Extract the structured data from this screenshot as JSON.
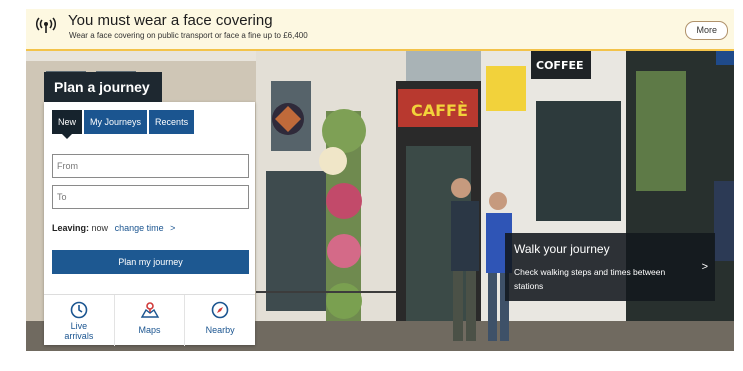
{
  "alert": {
    "icon": "signal-broadcast-icon",
    "title": "You must wear a face covering",
    "subtitle": "Wear a face covering on public transport or face a fine up to £6,400",
    "more_label": "More"
  },
  "scene": {
    "coffee_sign": "COFFEE"
  },
  "planner": {
    "title": "Plan a journey",
    "tabs": [
      {
        "label": "New"
      },
      {
        "label": "My Journeys"
      },
      {
        "label": "Recents"
      }
    ],
    "from_placeholder": "From",
    "to_placeholder": "To",
    "leaving_label": "Leaving:",
    "leaving_value": "now",
    "change_time_label": "change time",
    "change_time_chevron": ">",
    "plan_button": "Plan my journey"
  },
  "quick_links": [
    {
      "label": "Live arrivals",
      "icon": "clock-icon"
    },
    {
      "label": "Maps",
      "icon": "map-pin-icon"
    },
    {
      "label": "Nearby",
      "icon": "compass-icon"
    }
  ],
  "walk_card": {
    "title": "Walk your journey",
    "description": "Check walking steps and times between stations",
    "chevron": ">"
  },
  "colors": {
    "brand_blue": "#1d5891",
    "dark_navy": "#16232d",
    "alert_bg": "#fdf8e1",
    "alert_border": "#f3c34a"
  }
}
